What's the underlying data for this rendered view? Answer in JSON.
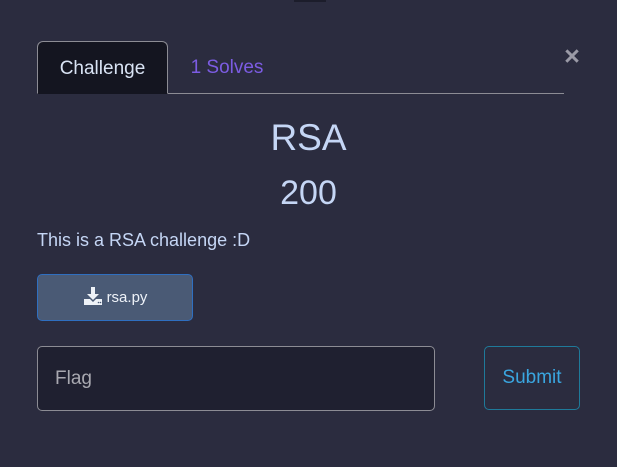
{
  "modal": {
    "close_glyph": "×",
    "tabs": [
      {
        "label": "Challenge",
        "active": true
      },
      {
        "label": "1 Solves",
        "active": false
      }
    ],
    "challenge": {
      "name": "RSA",
      "value": "200",
      "description": "This is a RSA challenge :D"
    },
    "file": {
      "label": "rsa.py",
      "icon": "download-icon"
    },
    "form": {
      "flag_placeholder": "Flag",
      "submit_label": "Submit"
    }
  },
  "colors": {
    "background": "#2b2c3f",
    "title": "#c5d6f5",
    "solves_link": "#7c5ce3",
    "submit_accent": "#3aa6e0"
  }
}
